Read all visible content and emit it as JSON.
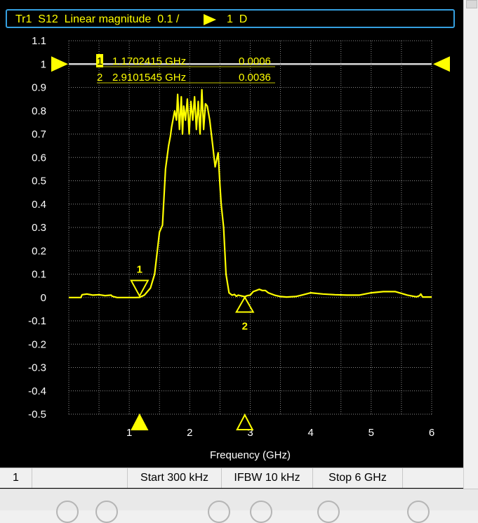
{
  "trace": {
    "title": "Tr1  S12  Linear magnitude  0.1 /",
    "title_suffix": "1  D"
  },
  "markers": [
    {
      "id": "1",
      "freq": "1.1702415 GHz",
      "value": "0.0006"
    },
    {
      "id": "2",
      "freq": "2.9101545 GHz",
      "value": "0.0036"
    }
  ],
  "status_bar": {
    "channel": "1",
    "start": "Start 300 kHz",
    "ifbw": "IFBW 10 kHz",
    "stop": "Stop 6 GHz"
  },
  "colors": {
    "trace": "#ffff00",
    "grid": "#8a8a8a",
    "reference_line": "#d8d8d8",
    "frame_accent": "#35a0e0"
  },
  "chart_data": {
    "type": "line",
    "xlabel": "Frequency (GHz)",
    "ylabel": "",
    "xlim": [
      0.0003,
      6
    ],
    "ylim": [
      -0.5,
      1.1
    ],
    "x_ticks": [
      1,
      2,
      3,
      4,
      5,
      6
    ],
    "x_tick_labels": [
      "1",
      "2",
      "3",
      "4",
      "5",
      "6"
    ],
    "y_ticks": [
      1.1,
      1,
      0.9,
      0.8,
      0.7,
      0.6,
      0.5,
      0.4,
      0.3,
      0.2,
      0.1,
      0,
      -0.1,
      -0.2,
      -0.3,
      -0.4,
      -0.5
    ],
    "y_tick_labels": [
      "1.1",
      "1",
      "0.9",
      "0.8",
      "0.7",
      "0.6",
      "0.5",
      "0.4",
      "0.3",
      "0.2",
      "0.1",
      "0",
      "-0.1",
      "-0.2",
      "-0.3",
      "-0.4",
      "-0.5"
    ],
    "reference_level": 1,
    "grid": true,
    "series": [
      {
        "x": [
          0.0003,
          0.2,
          0.22,
          0.3,
          0.4,
          0.5,
          0.6,
          0.7,
          0.72,
          0.8,
          1.0,
          1.1,
          1.17,
          1.25,
          1.35,
          1.42,
          1.5,
          1.55,
          1.6,
          1.65,
          1.68,
          1.7,
          1.75,
          1.78,
          1.8,
          1.83,
          1.86,
          1.88,
          1.9,
          1.93,
          1.96,
          1.99,
          2.02,
          2.05,
          2.08,
          2.11,
          2.14,
          2.17,
          2.2,
          2.23,
          2.26,
          2.29,
          2.33,
          2.38,
          2.42,
          2.47,
          2.5,
          2.52,
          2.56,
          2.6,
          2.65,
          2.7,
          2.74,
          2.77,
          2.8,
          2.85,
          2.91,
          2.95,
          3.0,
          3.05,
          3.1,
          3.15,
          3.2,
          3.25,
          3.3,
          3.4,
          3.5,
          3.6,
          3.75,
          3.85,
          4.0,
          4.2,
          4.4,
          4.6,
          4.8,
          5.0,
          5.2,
          5.4,
          5.6,
          5.7,
          5.75,
          5.8,
          5.82,
          5.85,
          6.0
        ],
        "y": [
          0,
          0,
          0.012,
          0.015,
          0.01,
          0.012,
          0.008,
          0.01,
          0.005,
          0.0,
          0.0,
          0.0,
          0.0006,
          0.01,
          0.04,
          0.1,
          0.28,
          0.31,
          0.55,
          0.65,
          0.69,
          0.73,
          0.8,
          0.76,
          0.87,
          0.72,
          0.86,
          0.7,
          0.82,
          0.76,
          0.85,
          0.7,
          0.84,
          0.76,
          0.86,
          0.72,
          0.84,
          0.7,
          0.89,
          0.72,
          0.83,
          0.82,
          0.76,
          0.65,
          0.56,
          0.62,
          0.48,
          0.4,
          0.3,
          0.1,
          0.02,
          0.01,
          0.013,
          0.005,
          0.01,
          0.007,
          0.0036,
          0.008,
          0.01,
          0.025,
          0.03,
          0.035,
          0.03,
          0.03,
          0.02,
          0.01,
          0.004,
          0.002,
          0.004,
          0.01,
          0.02,
          0.015,
          0.012,
          0.01,
          0.01,
          0.02,
          0.025,
          0.025,
          0.01,
          0.005,
          0.003,
          0.008,
          0.015,
          0.002,
          0.002
        ]
      }
    ],
    "marker_positions": [
      {
        "id": "1",
        "x": 1.1702415,
        "y": 0.0006,
        "label_side": "above"
      },
      {
        "id": "2",
        "x": 2.9101545,
        "y": 0.0036,
        "label_side": "below"
      }
    ]
  }
}
